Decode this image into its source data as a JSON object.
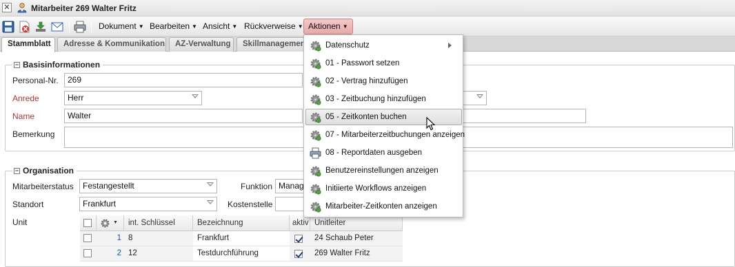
{
  "window": {
    "title": "Mitarbeiter 269 Walter Fritz",
    "close_glyph": "✕"
  },
  "toolbar": {
    "icons": [
      "save-icon",
      "delete-icon",
      "download-icon",
      "mail-icon",
      "print-icon"
    ],
    "menus": [
      {
        "label": "Dokument"
      },
      {
        "label": "Bearbeiten"
      },
      {
        "label": "Ansicht"
      },
      {
        "label": "Rückverweise"
      },
      {
        "label": "Aktionen",
        "active": true
      }
    ]
  },
  "tabs": [
    {
      "label": "Stammblatt",
      "active": true
    },
    {
      "label": "Adresse & Kommunikation"
    },
    {
      "label": "AZ-Verwaltung"
    },
    {
      "label": "Skillmanagement"
    }
  ],
  "basis": {
    "legend": "Basisinformationen",
    "personal_nr": {
      "label": "Personal-Nr.",
      "value": "269"
    },
    "anrede": {
      "label": "Anrede",
      "value": "Herr"
    },
    "name": {
      "label": "Name",
      "value": "Walter"
    },
    "bemerkung": {
      "label": "Bemerkung",
      "value": ""
    }
  },
  "organisation": {
    "legend": "Organisation",
    "mitarbeiterstatus": {
      "label": "Mitarbeiterstatus",
      "value": "Festangestellt"
    },
    "funktion": {
      "label": "Funktion",
      "value": "Manag"
    },
    "standort": {
      "label": "Standort",
      "value": "Frankfurt"
    },
    "kostenstelle": {
      "label": "Kostenstelle",
      "value": ""
    },
    "unit": {
      "label": "Unit"
    }
  },
  "unit_grid": {
    "columns": [
      "int. Schlüssel",
      "Bezeichnung",
      "aktiv",
      "Unitleiter"
    ],
    "rows": [
      {
        "nr": "1",
        "schluessel": "8",
        "bezeichnung": "Frankfurt",
        "aktiv": true,
        "unitleiter": "24 Schaub Peter"
      },
      {
        "nr": "2",
        "schluessel": "12",
        "bezeichnung": "Testdurchführung",
        "aktiv": true,
        "unitleiter": "269 Walter Fritz"
      }
    ]
  },
  "aktionen_menu": {
    "items": [
      {
        "label": "Datenschutz",
        "icon": "gear-icon",
        "submenu": true
      },
      {
        "label": "01 - Passwort setzen",
        "icon": "gear-icon"
      },
      {
        "label": "02 - Vertrag hinzufügen",
        "icon": "gear-icon"
      },
      {
        "label": "03 - Zeitbuchung hinzufügen",
        "icon": "gear-icon"
      },
      {
        "label": "05 - Zeitkonten buchen",
        "icon": "gear-icon",
        "highlighted": true
      },
      {
        "label": "07 - Mitarbeiterzeitbuchungen anzeigen",
        "icon": "gear-icon"
      },
      {
        "label": "08 - Reportdaten ausgeben",
        "icon": "printer-icon"
      },
      {
        "label": "Benutzereinstellungen anzeigen",
        "icon": "gear-icon"
      },
      {
        "label": "Initiierte Workflows anzeigen",
        "icon": "gear-icon"
      },
      {
        "label": "Mitarbeiter-Zeitkonten anzeigen",
        "icon": "gear-icon"
      }
    ]
  },
  "colors": {
    "accent_menu": "#e7a9a9",
    "required_label": "#b33333",
    "link_blue": "#1a4fb4"
  }
}
